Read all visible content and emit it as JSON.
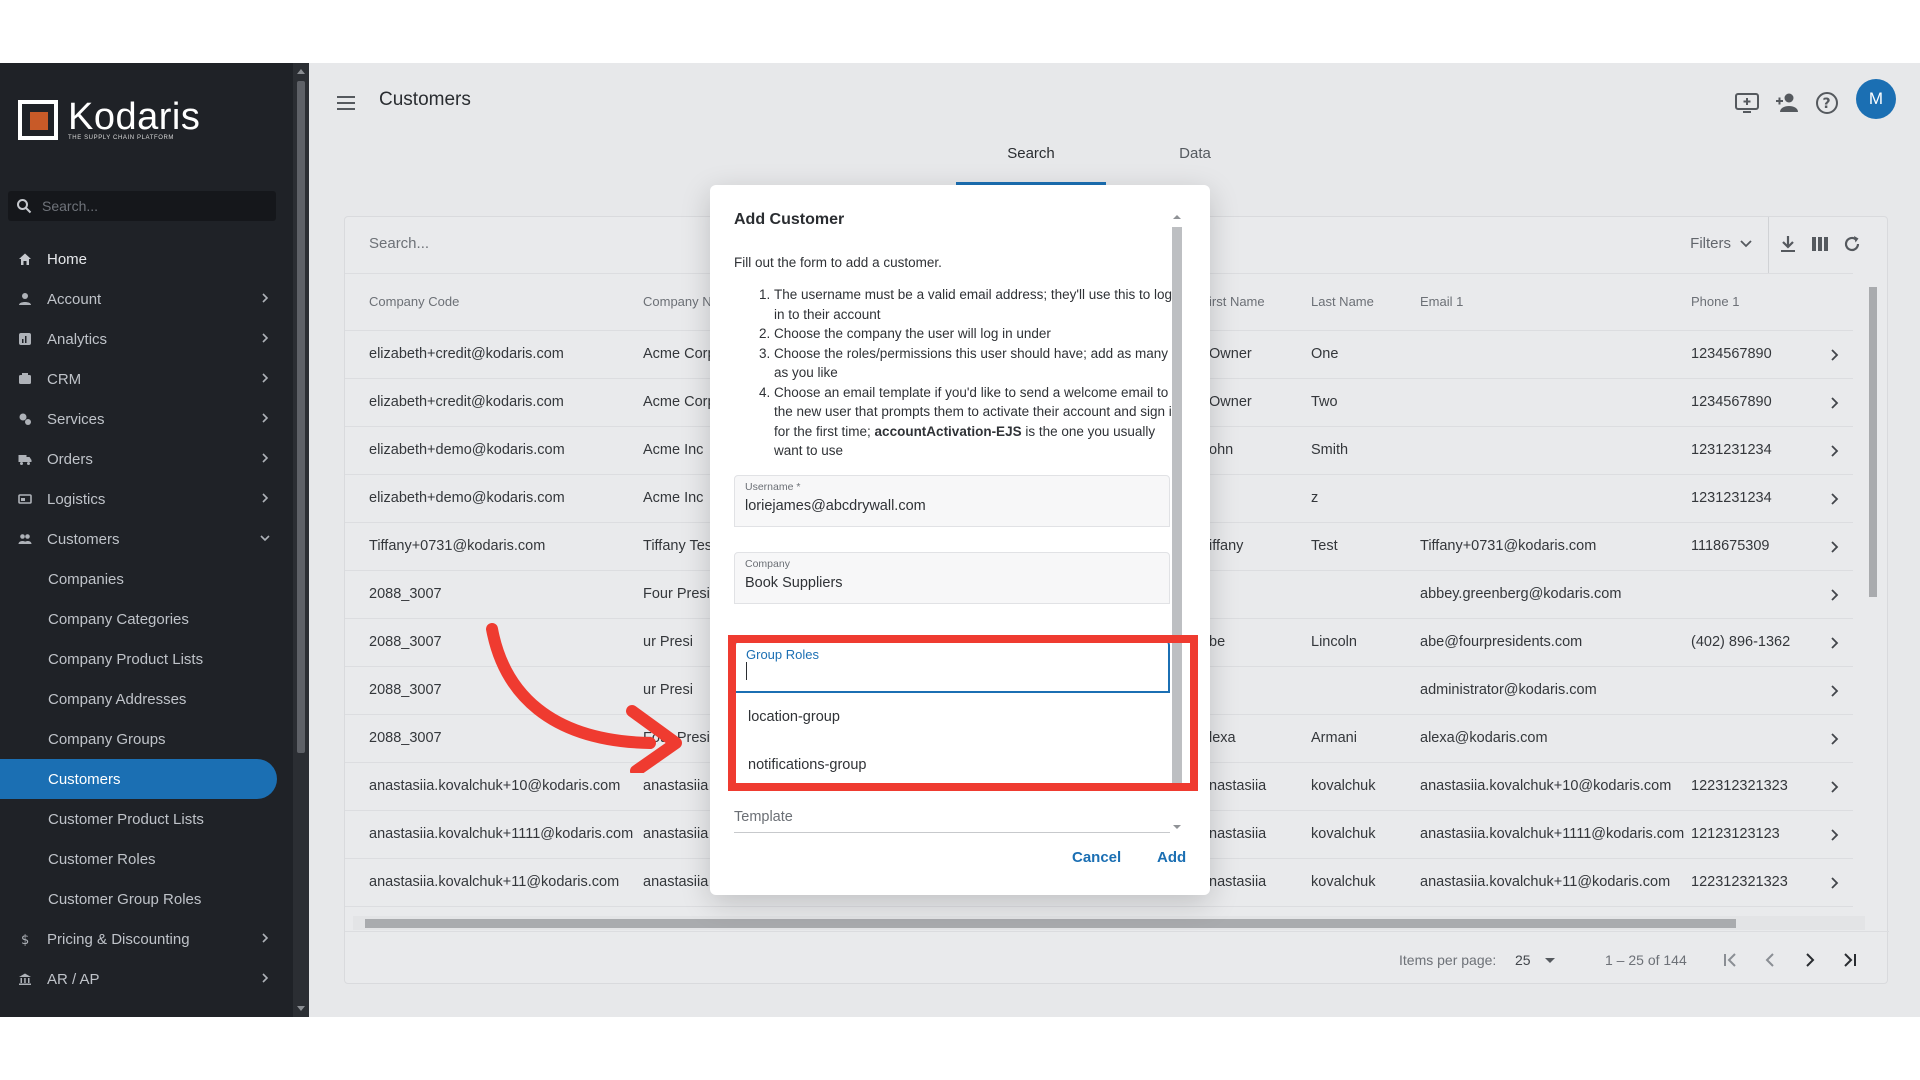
{
  "sidebar": {
    "logo_name": "Kodaris",
    "logo_tagline": "THE SUPPLY CHAIN PLATFORM",
    "search_placeholder": "Search...",
    "items": [
      {
        "label": "Home",
        "icon": "home-icon"
      },
      {
        "label": "Account",
        "icon": "person-icon"
      },
      {
        "label": "Analytics",
        "icon": "analytics-icon"
      },
      {
        "label": "CRM",
        "icon": "crm-icon"
      },
      {
        "label": "Services",
        "icon": "services-icon"
      },
      {
        "label": "Orders",
        "icon": "truck-icon"
      },
      {
        "label": "Logistics",
        "icon": "logistics-icon"
      },
      {
        "label": "Customers",
        "icon": "people-icon"
      }
    ],
    "customer_subitems": [
      "Companies",
      "Company Categories",
      "Company Product Lists",
      "Company Addresses",
      "Company Groups",
      "Customers",
      "Customer Product Lists",
      "Customer Roles",
      "Customer Group Roles"
    ],
    "after_items": [
      {
        "label": "Pricing & Discounting",
        "icon": "dollar-icon"
      },
      {
        "label": "AR / AP",
        "icon": "bank-icon"
      }
    ]
  },
  "header": {
    "title": "Customers",
    "avatar_initial": "M",
    "tabs": [
      "Search",
      "Data"
    ]
  },
  "table": {
    "search_placeholder": "Search...",
    "filters_label": "Filters",
    "columns": [
      "Company Code",
      "Company N",
      "irst Name",
      "Last Name",
      "Email 1",
      "Phone 1"
    ],
    "rows": [
      [
        "elizabeth+credit@kodaris.com",
        "Acme Corp",
        "Owner",
        "One",
        "",
        "1234567890"
      ],
      [
        "elizabeth+credit@kodaris.com",
        "Acme Corp",
        "Owner",
        "Two",
        "",
        "1234567890"
      ],
      [
        "elizabeth+demo@kodaris.com",
        "Acme Inc",
        "ohn",
        "Smith",
        "",
        "1231231234"
      ],
      [
        "elizabeth+demo@kodaris.com",
        "Acme Inc",
        "",
        "z",
        "",
        "1231231234"
      ],
      [
        "Tiffany+0731@kodaris.com",
        "Tiffany Tes",
        "iffany",
        "Test",
        "Tiffany+0731@kodaris.com",
        "1118675309"
      ],
      [
        "2088_3007",
        "Four Presi",
        "",
        "",
        "abbey.greenberg@kodaris.com",
        ""
      ],
      [
        "2088_3007",
        "ur Presi",
        "be",
        "Lincoln",
        "abe@fourpresidents.com",
        "(402) 896-1362"
      ],
      [
        "2088_3007",
        "ur Presi",
        "",
        "",
        "administrator@kodaris.com",
        ""
      ],
      [
        "2088_3007",
        "Four Presi",
        "lexa",
        "Armani",
        "alexa@kodaris.com",
        ""
      ],
      [
        "anastasiia.kovalchuk+10@kodaris.com",
        "anastasiia",
        "nastasiia",
        "kovalchuk",
        "anastasiia.kovalchuk+10@kodaris.com",
        "122312321323"
      ],
      [
        "anastasiia.kovalchuk+1111@kodaris.com",
        "anastasiia",
        "nastasiia",
        "kovalchuk",
        "anastasiia.kovalchuk+1111@kodaris.com",
        "12123123123"
      ],
      [
        "anastasiia.kovalchuk+11@kodaris.com",
        "anastasiia",
        "nastasiia",
        "kovalchuk",
        "anastasiia.kovalchuk+11@kodaris.com",
        "122312321323"
      ]
    ],
    "pager": {
      "items_per_page_label": "Items per page:",
      "items_per_page_value": "25",
      "range": "1 – 25 of 144"
    }
  },
  "dialog": {
    "title": "Add Customer",
    "intro": "Fill out the form to add a customer.",
    "steps": [
      {
        "text": "The username must be a valid email address; they'll use this to log in to their account"
      },
      {
        "text": "Choose the company the user will log in under"
      },
      {
        "text": "Choose the roles/permissions this user should have; add as many as you like"
      },
      {
        "text": "Choose an email template if you'd like to send a welcome email to the new user that prompts them to activate their account and sign in for the first time;",
        "bold": "accountActivation-EJS",
        "after": "is the one you usually want to use"
      }
    ],
    "username_label": "Username *",
    "username_value": "loriejames@abcdrywall.com",
    "company_label": "Company",
    "company_value": "Book Suppliers",
    "group_roles_label": "Group Roles",
    "role_options": [
      "location-group",
      "notifications-group"
    ],
    "template_label": "Template",
    "cancel_label": "Cancel",
    "add_label": "Add"
  },
  "colors": {
    "accent": "#1b6fb3",
    "sidebar_bg": "#1f2227",
    "annotation": "#ef3b30"
  }
}
